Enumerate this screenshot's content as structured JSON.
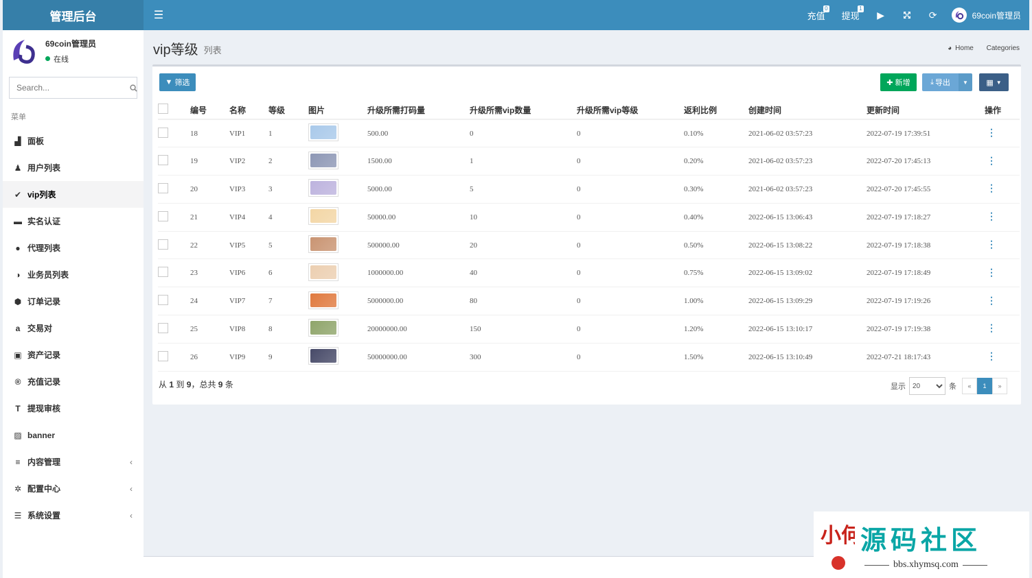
{
  "header": {
    "brand": "管理后台",
    "recharge_label": "充值",
    "recharge_badge": "0",
    "withdraw_label": "提现",
    "withdraw_badge": "1",
    "username": "69coin管理员"
  },
  "sidebar": {
    "user_name": "69coin管理员",
    "user_status": "在线",
    "search_placeholder": "Search...",
    "menu_header": "菜单",
    "items": [
      {
        "label": "面板",
        "icon": "area-chart-icon",
        "glyph": "▟"
      },
      {
        "label": "用户列表",
        "icon": "user-icon",
        "glyph": "♟"
      },
      {
        "label": "vip列表",
        "icon": "check-circle-icon",
        "glyph": "✔",
        "active": true
      },
      {
        "label": "实名认证",
        "icon": "credit-card-icon",
        "glyph": "▬"
      },
      {
        "label": "代理列表",
        "icon": "circle-icon",
        "glyph": "●"
      },
      {
        "label": "业务员列表",
        "icon": "adjust-icon",
        "glyph": "◑"
      },
      {
        "label": "订单记录",
        "icon": "cube-icon",
        "glyph": "⬢"
      },
      {
        "label": "交易对",
        "icon": "amazon-icon",
        "glyph": "a"
      },
      {
        "label": "资产记录",
        "icon": "money-icon",
        "glyph": "▣"
      },
      {
        "label": "充值记录",
        "icon": "registered-icon",
        "glyph": "®"
      },
      {
        "label": "提现审核",
        "icon": "text-height-icon",
        "glyph": "T"
      },
      {
        "label": "banner",
        "icon": "image-icon",
        "glyph": "▨"
      },
      {
        "label": "内容管理",
        "icon": "list-icon",
        "glyph": "≡",
        "chevron": "‹"
      },
      {
        "label": "配置中心",
        "icon": "cogs-icon",
        "glyph": "✲",
        "chevron": "‹"
      },
      {
        "label": "系统设置",
        "icon": "list-alt-icon",
        "glyph": "☰",
        "chevron": "‹"
      }
    ]
  },
  "page": {
    "title": "vip等级",
    "subtitle": "列表",
    "breadcrumb_home": "Home",
    "breadcrumb_current": "Categories"
  },
  "toolbar": {
    "filter_label": "筛选",
    "add_label": "新增",
    "export_label": "导出"
  },
  "table": {
    "headers": [
      "编号",
      "名称",
      "等级",
      "图片",
      "升级所需打码量",
      "升级所需vip数量",
      "升级所需vip等级",
      "返利比例",
      "创建时间",
      "更新时间",
      "操作"
    ],
    "rows": [
      {
        "id": "18",
        "name": "VIP1",
        "level": "1",
        "color": "#a9c9ea",
        "bet": "500.00",
        "vip_count": "0",
        "vip_level": "0",
        "rebate": "0.10%",
        "created": "2021-06-02 03:57:23",
        "updated": "2022-07-19 17:39:51"
      },
      {
        "id": "19",
        "name": "VIP2",
        "level": "2",
        "color": "#8d97b5",
        "bet": "1500.00",
        "vip_count": "1",
        "vip_level": "0",
        "rebate": "0.20%",
        "created": "2021-06-02 03:57:23",
        "updated": "2022-07-20 17:45:13"
      },
      {
        "id": "20",
        "name": "VIP3",
        "level": "3",
        "color": "#bdb3de",
        "bet": "5000.00",
        "vip_count": "5",
        "vip_level": "0",
        "rebate": "0.30%",
        "created": "2021-06-02 03:57:23",
        "updated": "2022-07-20 17:45:55"
      },
      {
        "id": "21",
        "name": "VIP4",
        "level": "4",
        "color": "#f3d6a5",
        "bet": "50000.00",
        "vip_count": "10",
        "vip_level": "0",
        "rebate": "0.40%",
        "created": "2022-06-15 13:06:43",
        "updated": "2022-07-19 17:18:27"
      },
      {
        "id": "22",
        "name": "VIP5",
        "level": "5",
        "color": "#c99472",
        "bet": "500000.00",
        "vip_count": "20",
        "vip_level": "0",
        "rebate": "0.50%",
        "created": "2022-06-15 13:08:22",
        "updated": "2022-07-19 17:18:38"
      },
      {
        "id": "23",
        "name": "VIP6",
        "level": "6",
        "color": "#eccfb1",
        "bet": "1000000.00",
        "vip_count": "40",
        "vip_level": "0",
        "rebate": "0.75%",
        "created": "2022-06-15 13:09:02",
        "updated": "2022-07-19 17:18:49"
      },
      {
        "id": "24",
        "name": "VIP7",
        "level": "7",
        "color": "#e07a3f",
        "bet": "5000000.00",
        "vip_count": "80",
        "vip_level": "0",
        "rebate": "1.00%",
        "created": "2022-06-15 13:09:29",
        "updated": "2022-07-19 17:19:26"
      },
      {
        "id": "25",
        "name": "VIP8",
        "level": "8",
        "color": "#8fa56a",
        "bet": "20000000.00",
        "vip_count": "150",
        "vip_level": "0",
        "rebate": "1.20%",
        "created": "2022-06-15 13:10:17",
        "updated": "2022-07-19 17:19:38"
      },
      {
        "id": "26",
        "name": "VIP9",
        "level": "9",
        "color": "#474a68",
        "bet": "50000000.00",
        "vip_count": "300",
        "vip_level": "0",
        "rebate": "1.50%",
        "created": "2022-06-15 13:10:49",
        "updated": "2022-07-21 18:17:43"
      }
    ]
  },
  "footer": {
    "summary_prefix": "从",
    "summary_from": "1",
    "summary_to_word": "到",
    "summary_to": "9",
    "summary_total_word": "，总共",
    "summary_total": "9",
    "summary_suffix": "条",
    "show_label": "显示",
    "page_size": "20",
    "page_size_suffix": "条",
    "prev": "«",
    "current_page": "1",
    "next": "»"
  },
  "watermark": {
    "title": "源码社区",
    "url": "bbs.xhymsq.com",
    "seal": "小何"
  },
  "colors": {
    "primary": "#3c8dbc",
    "success": "#00a65a",
    "sidebar_bg": "#ffffff",
    "content_bg": "#ecf0f5"
  }
}
